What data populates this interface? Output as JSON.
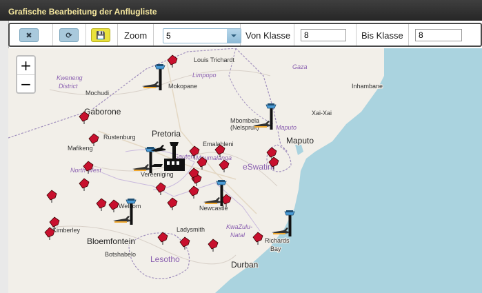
{
  "window": {
    "title": "Grafische Bearbeitung der Anflugliste"
  },
  "toolbar": {
    "close_icon": "close-icon",
    "refresh_icon": "refresh-icon",
    "save_icon": "save-icon",
    "zoom_label": "Zoom",
    "zoom_value": "5",
    "von_klasse_label": "Von Klasse",
    "von_klasse_value": "8",
    "bis_klasse_label": "Bis Klasse",
    "bis_klasse_value": "8"
  },
  "map_controls": {
    "zoom_in": "+",
    "zoom_out": "−"
  },
  "map": {
    "colors": {
      "water": "#aad3df",
      "land": "#f2efe9",
      "flag": "#c8102e",
      "border": "#a08fbd"
    },
    "places": [
      {
        "name": "Louis Trichardt",
        "kind": "city"
      },
      {
        "name": "Limpopo",
        "kind": "province"
      },
      {
        "name": "Gaza",
        "kind": "province"
      },
      {
        "name": "Kweneng",
        "kind": "district"
      },
      {
        "name": "District",
        "kind": "district"
      },
      {
        "name": "Mochudi",
        "kind": "city"
      },
      {
        "name": "Mokopane",
        "kind": "city"
      },
      {
        "name": "Inhambane",
        "kind": "city"
      },
      {
        "name": "Gaborone",
        "kind": "major"
      },
      {
        "name": "Xai-Xai",
        "kind": "city"
      },
      {
        "name": "Mbombela",
        "kind": "city"
      },
      {
        "name": "(Nelspruit)",
        "kind": "city"
      },
      {
        "name": "Maputo",
        "kind": "province"
      },
      {
        "name": "Rustenburg",
        "kind": "city"
      },
      {
        "name": "Pretoria",
        "kind": "major"
      },
      {
        "name": "Mafikeng",
        "kind": "city"
      },
      {
        "name": "Maputo",
        "kind": "major"
      },
      {
        "name": "Emalahleni",
        "kind": "city"
      },
      {
        "name": "Gauteng",
        "kind": "province"
      },
      {
        "name": "Mpumalanga",
        "kind": "province"
      },
      {
        "name": "eSwatini",
        "kind": "country"
      },
      {
        "name": "North West",
        "kind": "province"
      },
      {
        "name": "Vereeniging",
        "kind": "city"
      },
      {
        "name": "Welkom",
        "kind": "city"
      },
      {
        "name": "Newcastle",
        "kind": "city"
      },
      {
        "name": "KwaZulu-",
        "kind": "province"
      },
      {
        "name": "Natal",
        "kind": "province"
      },
      {
        "name": "Kimberley",
        "kind": "city"
      },
      {
        "name": "Ladysmith",
        "kind": "city"
      },
      {
        "name": "Richards",
        "kind": "city"
      },
      {
        "name": "Bay",
        "kind": "city"
      },
      {
        "name": "Bloemfontein",
        "kind": "major"
      },
      {
        "name": "Botshabelo",
        "kind": "city"
      },
      {
        "name": "Lesotho",
        "kind": "country"
      },
      {
        "name": "Durban",
        "kind": "major"
      }
    ],
    "flag_icon": "red-flag-marker",
    "airport_icon": "control-tower-airplane-marker",
    "hub_icon": "airport-terminal-marker"
  }
}
